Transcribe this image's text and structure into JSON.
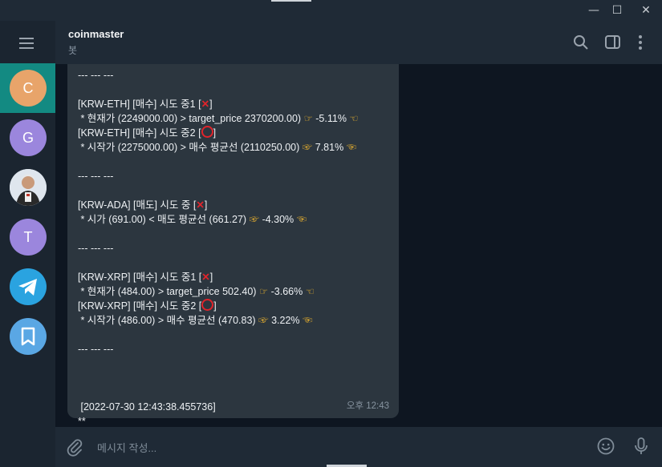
{
  "window": {
    "minimize_glyph": "—",
    "maximize_glyph": "☐",
    "close_glyph": "✕"
  },
  "sidebar": {
    "items": [
      {
        "initial": "C",
        "color": "#e8a46a",
        "active": true
      },
      {
        "initial": "G",
        "color": "#9b86dd",
        "active": false
      },
      {
        "initial": "",
        "color": "#cfd8e3",
        "active": false,
        "icon": "profile-photo"
      },
      {
        "initial": "T",
        "color": "#9b86dd",
        "active": false
      },
      {
        "initial": "",
        "color": "#2aa3e0",
        "active": false,
        "icon": "telegram-icon"
      },
      {
        "initial": "",
        "color": "#5aa7e4",
        "active": false,
        "icon": "bookmark-icon"
      }
    ]
  },
  "header": {
    "title": "coinmaster",
    "subtitle": "봇"
  },
  "message": {
    "lines": [
      "--- --- ---",
      "",
      "[KRW-ETH] [매수] 시도 중1 [❌]",
      " * 현재가 (2249000.00) > target_price 2370200.00) 👉 -5.11% 👈",
      "[KRW-ETH] [매수] 시도 중2 [⭕]",
      " * 시작가 (2275000.00) > 매수 평균선 (2110250.00) 👉 7.81% 👈",
      "",
      "--- --- ---",
      "",
      "[KRW-ADA] [매도] 시도 중 [❌]",
      " * 시가 (691.00) < 매도 평균선 (661.27) 👉 -4.30% 👈",
      "",
      "--- --- ---",
      "",
      "[KRW-XRP] [매수] 시도 중1 [❌]",
      " * 현재가 (484.00) > target_price 502.40) 👉 -3.66% 👈",
      "[KRW-XRP] [매수] 시도 중2 [⭕]",
      " * 시작가 (486.00) > 매수 평균선 (470.83) 👉 3.22% 👈",
      "",
      "--- --- ---",
      "",
      "",
      "",
      " [2022-07-30 12:43:38.455736]",
      "**"
    ],
    "time": "오후 12:43"
  },
  "composer": {
    "placeholder": "메시지 작성..."
  }
}
